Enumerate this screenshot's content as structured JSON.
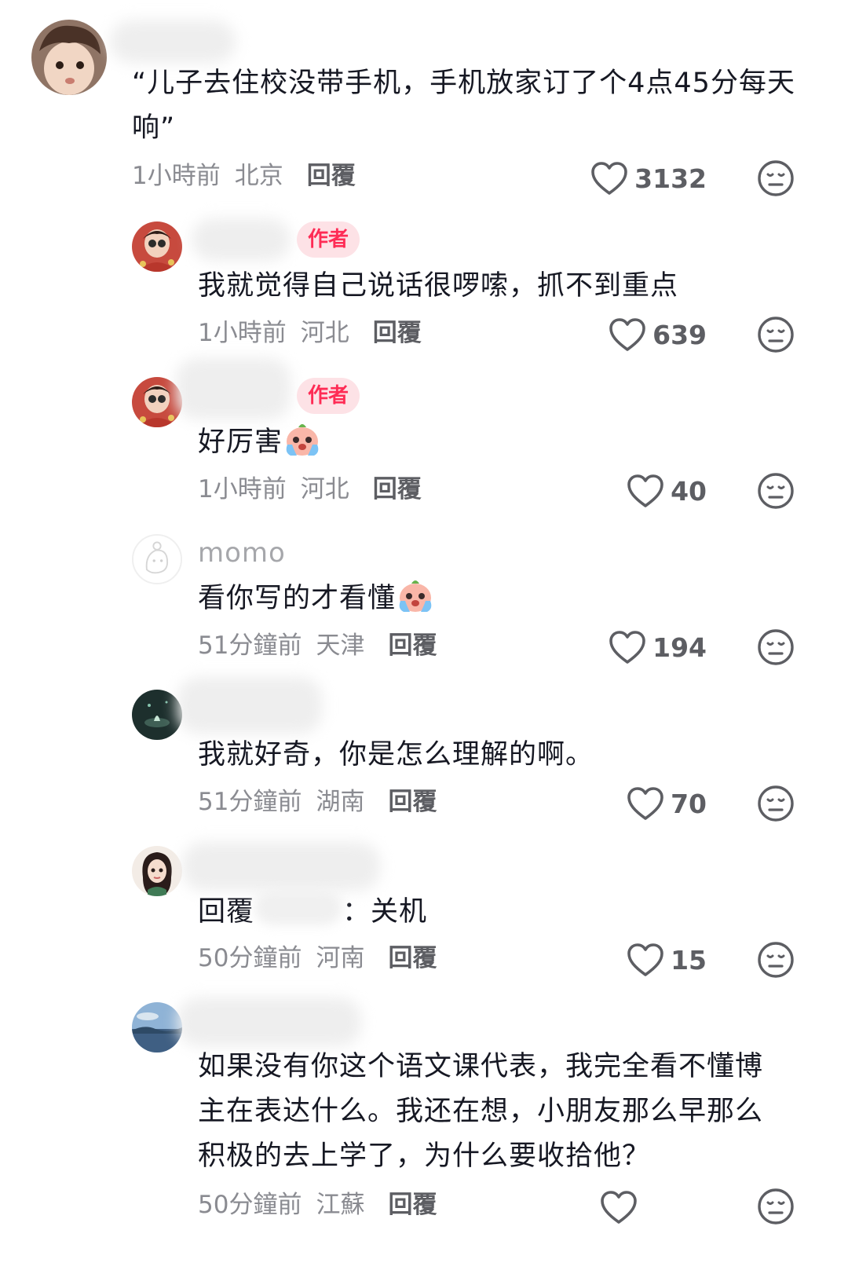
{
  "comments": [
    {
      "name": "",
      "text": "“儿子去住校没带手机，手机放家订了个4点45分每天响”",
      "time": "1小時前",
      "location": "北京",
      "reply": "回覆",
      "likes": "3132"
    },
    {
      "name": "",
      "badge": "作者",
      "text": "我就觉得自己说话很啰嗦，抓不到重点",
      "time": "1小時前",
      "location": "河北",
      "reply": "回覆",
      "likes": "639"
    },
    {
      "name": "",
      "badge": "作者",
      "text": "好厉害",
      "time": "1小時前",
      "location": "河北",
      "reply": "回覆",
      "likes": "40"
    },
    {
      "name": "momo",
      "text": "看你写的才看懂",
      "time": "51分鐘前",
      "location": "天津",
      "reply": "回覆",
      "likes": "194"
    },
    {
      "name": "",
      "text": "我就好奇，你是怎么理解的啊。",
      "time": "51分鐘前",
      "location": "湖南",
      "reply": "回覆",
      "likes": "70"
    },
    {
      "name": "",
      "text_prefix": "回覆",
      "text_suffix": "：关机",
      "time": "50分鐘前",
      "location": "河南",
      "reply": "回覆",
      "likes": "15"
    },
    {
      "name": "",
      "text": "如果没有你这个语文课代表，我完全看不懂博主在表达什么。我还在想，小朋友那么早那么积极的去上学了，为什么要收拾他？",
      "time": "50分鐘前",
      "location": "江蘇",
      "reply": "回覆",
      "likes": ""
    }
  ],
  "icons": {
    "like": "heart-outline-icon",
    "dislike": "neutral-face-icon",
    "emoji": "crying-face-emoji"
  },
  "colors": {
    "accent": "#fe2c55",
    "badge_bg": "#fde2e6",
    "meta": "#8a8b91"
  }
}
